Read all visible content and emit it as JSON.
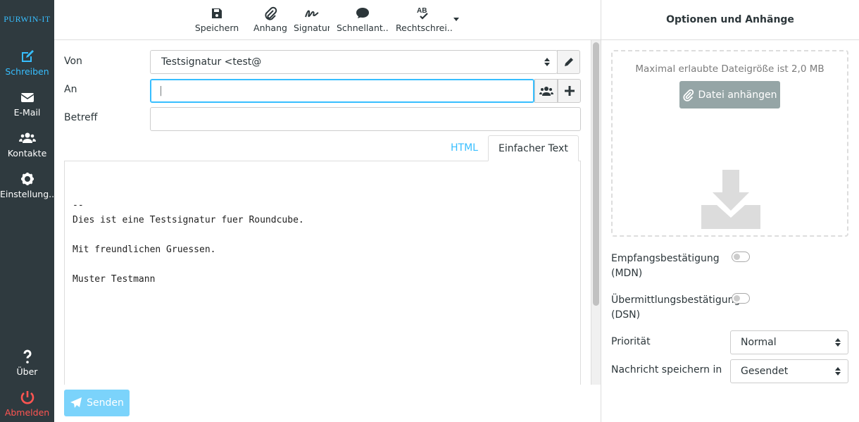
{
  "brand": {
    "logo_text": "PURWIN-IT"
  },
  "nav": {
    "compose": "Schreiben",
    "mail": "E-Mail",
    "contacts": "Kontakte",
    "settings": "Einstellung...",
    "about": "Über",
    "logout": "Abmelden"
  },
  "toolbar": {
    "save": "Speichern",
    "attach": "Anhang",
    "signature": "Signatur",
    "responses": "Schnellant...",
    "spell": "Rechtschrei..."
  },
  "compose": {
    "from_label": "Von",
    "from_value": "Testsignatur <test@",
    "to_label": "An",
    "to_value": "|",
    "subject_label": "Betreff",
    "subject_value": "",
    "tab_html": "HTML",
    "tab_plain": "Einfacher Text",
    "body": "\n\n--\nDies ist eine Testsignatur fuer Roundcube.\n\nMit freundlichen Gruessen.\n\nMuster Testmann",
    "send_label": "Senden"
  },
  "options": {
    "title": "Optionen und Anhänge",
    "max_size_text": "Maximal erlaubte Dateigröße ist 2,0 MB",
    "attach_button": "Datei anhängen",
    "mdn_label": "Empfangsbestätigung (MDN)",
    "dsn_label": "Übermittlungsbestätigung (DSN)",
    "priority_label": "Priorität",
    "priority_value": "Normal",
    "save_in_label": "Nachricht speichern in",
    "save_in_value": "Gesendet",
    "mdn_enabled": false,
    "dsn_enabled": false
  },
  "colors": {
    "accent": "#37beff",
    "nav_bg": "#2f3a3f",
    "logout": "#ff5552",
    "send_bg": "#7bd3fb",
    "attach_bg": "#95a5a6"
  }
}
